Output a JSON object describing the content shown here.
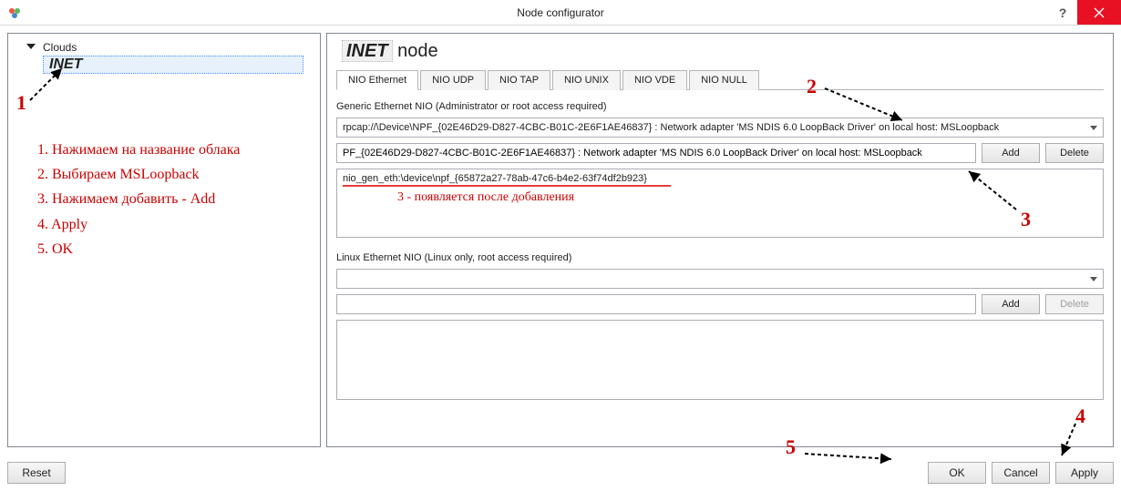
{
  "window": {
    "title": "Node configurator"
  },
  "tree": {
    "root_label": "Clouds",
    "child_label": "INET"
  },
  "instructions": {
    "l1": "1. Нажимаем на название облака",
    "l2": "2. Выбираем MSLoopback",
    "l3": "3. Нажимаем добавить - Add",
    "l4": "4. Apply",
    "l5": "5. OK"
  },
  "panel": {
    "brand": "INET",
    "title_suffix": " node"
  },
  "tabs": {
    "t0": "NIO Ethernet",
    "t1": "NIO UDP",
    "t2": "NIO TAP",
    "t3": "NIO UNIX",
    "t4": "NIO VDE",
    "t5": "NIO NULL"
  },
  "generic": {
    "label": "Generic Ethernet NIO (Administrator or root access required)",
    "combo_value": "rpcap://\\Device\\NPF_{02E46D29-D827-4CBC-B01C-2E6F1AE46837} : Network adapter 'MS NDIS 6.0 LoopBack Driver' on local host: MSLoopback",
    "text_value": "PF_{02E46D29-D827-4CBC-B01C-2E6F1AE46837} : Network adapter 'MS NDIS 6.0 LoopBack Driver' on local host: MSLoopback",
    "list_item": "nio_gen_eth:\\device\\npf_{65872a27-78ab-47c6-b4e2-63f74df2b923}",
    "caption": "3 - появляется после добавления",
    "add": "Add",
    "delete": "Delete"
  },
  "linux": {
    "label": "Linux Ethernet NIO (Linux only, root access required)",
    "combo_value": "",
    "text_value": "",
    "add": "Add",
    "delete": "Delete"
  },
  "buttons": {
    "reset": "Reset",
    "ok": "OK",
    "cancel": "Cancel",
    "apply": "Apply"
  },
  "anno": {
    "n1": "1",
    "n2": "2",
    "n3": "3",
    "n4": "4",
    "n5": "5"
  }
}
